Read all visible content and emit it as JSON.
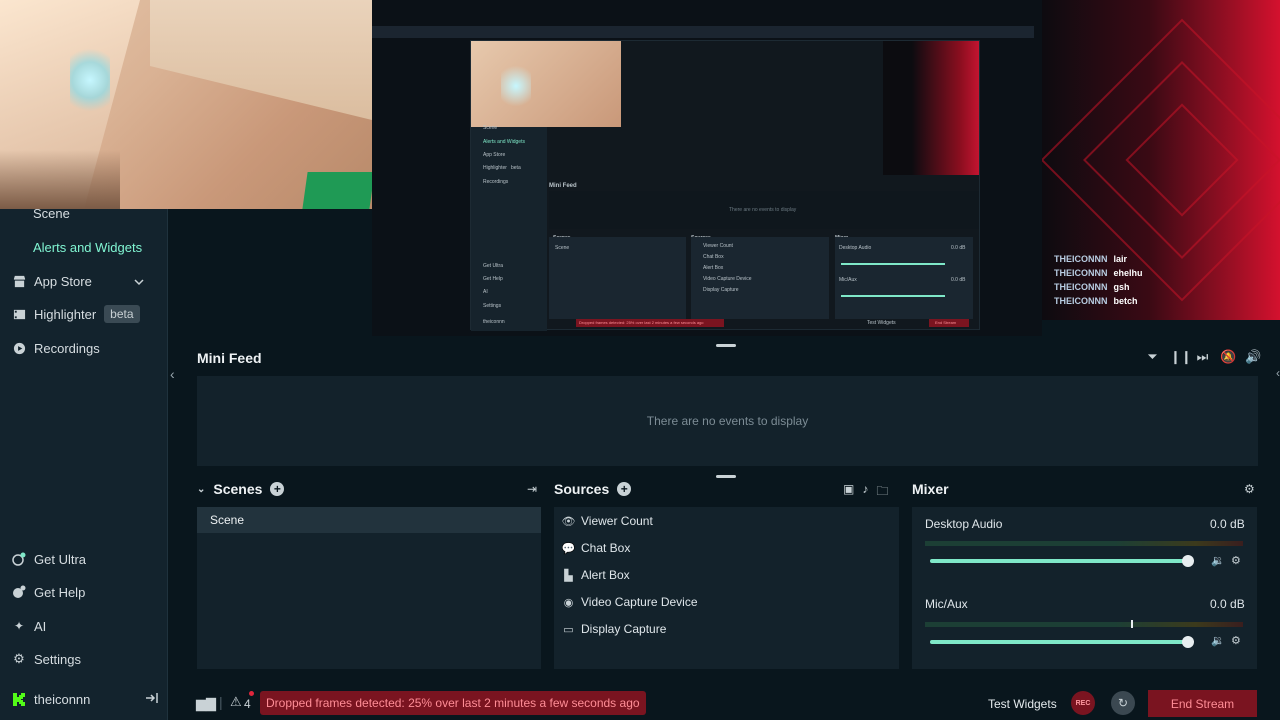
{
  "sidebar": {
    "scene_label": "Scene",
    "alerts_label": "Alerts and Widgets",
    "items": [
      {
        "label": "App Store",
        "icon": "store-icon"
      },
      {
        "label": "Highlighter",
        "icon": "film-icon",
        "badge": "beta"
      },
      {
        "label": "Recordings",
        "icon": "play-icon"
      }
    ],
    "bottom_items": [
      {
        "label": "Get Ultra",
        "icon": "ultra-icon"
      },
      {
        "label": "Get Help",
        "icon": "help-icon"
      },
      {
        "label": "AI",
        "icon": "sparkle-icon"
      },
      {
        "label": "Settings",
        "icon": "gear-icon"
      }
    ],
    "user": "theiconnn"
  },
  "chat": [
    {
      "user": "THEICONNN",
      "msg": "lair"
    },
    {
      "user": "THEICONNN",
      "msg": "ehelhu"
    },
    {
      "user": "THEICONNN",
      "msg": "gsh"
    },
    {
      "user": "THEICONNN",
      "msg": "betch"
    }
  ],
  "nested_preview": {
    "scene": "Scene",
    "alerts": "Alerts and Widgets",
    "app_store": "App Store",
    "highlighter": "Highlighter",
    "badge": "beta",
    "recordings": "Recordings",
    "mini_feed": "Mini Feed",
    "no_events": "There are no events to display",
    "scenes": "Scenes",
    "sources": "Sources",
    "mixer": "Mixer",
    "scene_row": "Scene",
    "src1": "Viewer Count",
    "src2": "Chat Box",
    "src3": "Alert Box",
    "src4": "Video Capture Device",
    "src5": "Display Capture",
    "desktop_audio": "Desktop Audio",
    "mic_aux": "Mic/Aux",
    "db": "0.0 dB",
    "get_ultra": "Get Ultra",
    "get_help": "Get Help",
    "ai": "AI",
    "settings": "Settings",
    "user": "theiconnn",
    "dropped": "Dropped frames detected: 25% over last 2 minutes a few seconds ago",
    "test_widgets": "Test Widgets",
    "end_stream": "End Stream"
  },
  "mini_feed": {
    "title": "Mini Feed",
    "empty": "There are no events to display"
  },
  "scenes": {
    "title": "Scenes",
    "items": [
      "Scene"
    ]
  },
  "sources": {
    "title": "Sources",
    "items": [
      {
        "label": "Viewer Count",
        "icon": "eye-icon"
      },
      {
        "label": "Chat Box",
        "icon": "chat-icon"
      },
      {
        "label": "Alert Box",
        "icon": "alert-box-icon"
      },
      {
        "label": "Video Capture Device",
        "icon": "webcam-icon"
      },
      {
        "label": "Display Capture",
        "icon": "monitor-icon"
      }
    ]
  },
  "mixer": {
    "title": "Mixer",
    "channels": [
      {
        "label": "Desktop Audio",
        "db": "0.0 dB",
        "volume": 1.0
      },
      {
        "label": "Mic/Aux",
        "db": "0.0 dB",
        "volume": 1.0
      }
    ]
  },
  "status": {
    "alert_count": "4",
    "dropped_frames": "Dropped frames detected: 25% over last 2 minutes a few seconds ago",
    "test_widgets": "Test Widgets",
    "rec": "REC",
    "end_stream": "End Stream"
  },
  "colors": {
    "accent": "#80f5d2",
    "danger": "#7a1420",
    "panel": "#13222b"
  }
}
